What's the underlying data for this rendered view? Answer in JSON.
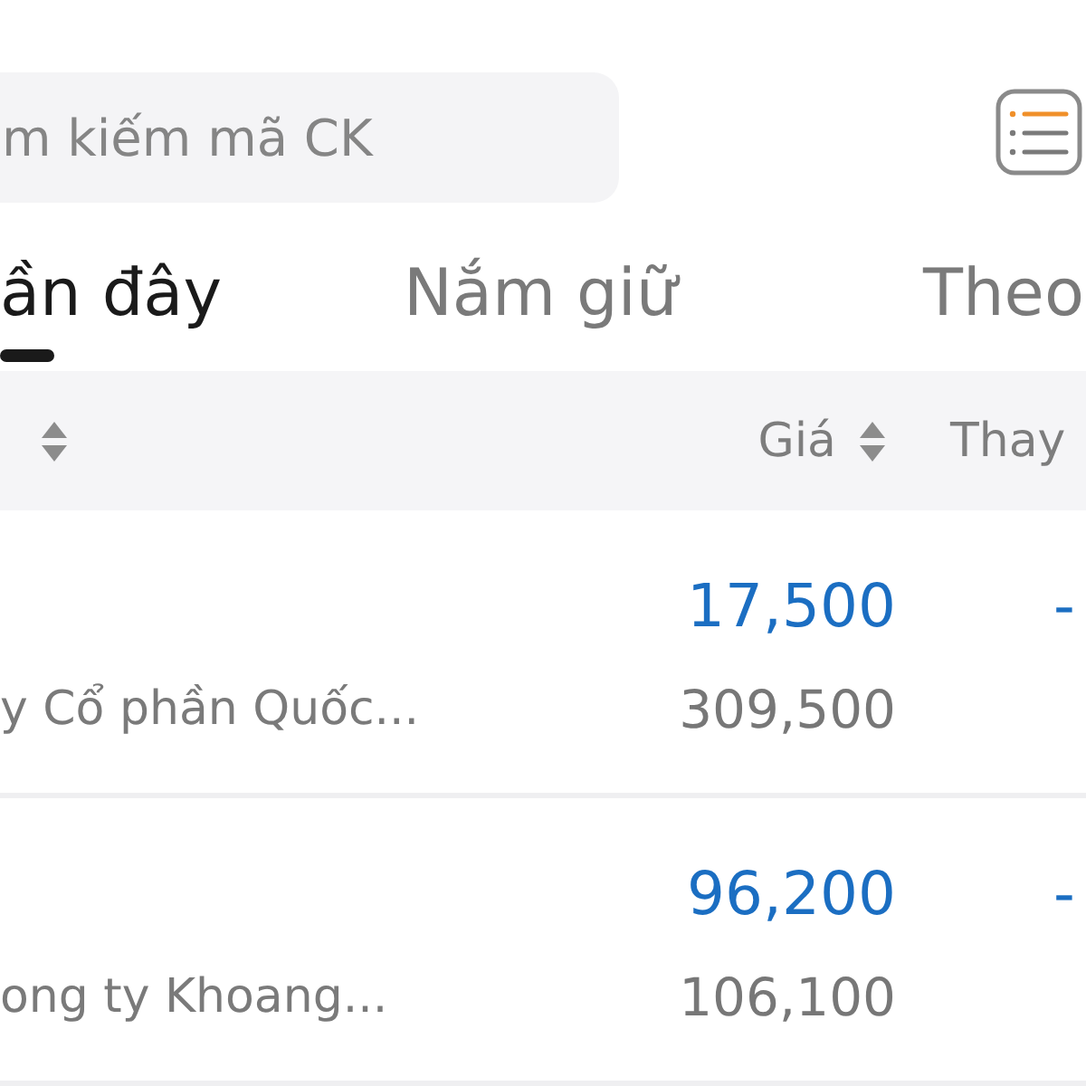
{
  "search": {
    "placeholder": "m kiếm mã CK"
  },
  "tabs": [
    {
      "label": "ần đây",
      "selected": true
    },
    {
      "label": "Nắm giữ",
      "selected": false
    },
    {
      "label": "Theo",
      "selected": false
    }
  ],
  "table": {
    "columns": [
      {
        "kind": "sort"
      },
      {
        "kind": "sort",
        "label": "Giá"
      },
      {
        "kind": "text",
        "label": "Thay"
      }
    ],
    "rows": [
      {
        "name": "y Cổ phần Quốc...",
        "price": "17,500",
        "price_line_2": "309,500",
        "change": "-",
        "color": "#1b6ec2"
      },
      {
        "name": "ong ty Khoang...",
        "price": "96,200",
        "price_line_2": "106,100",
        "change": "-",
        "color": "#1b6ec2"
      }
    ]
  }
}
